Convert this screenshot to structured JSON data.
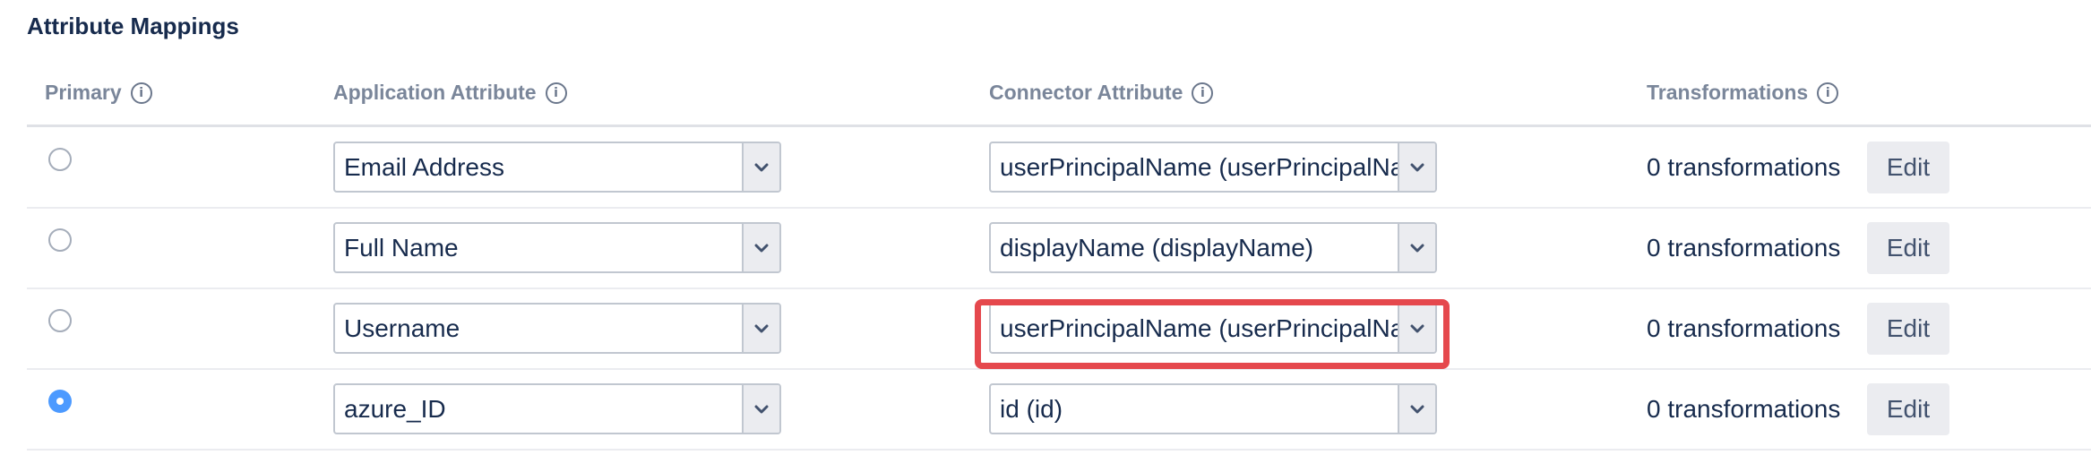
{
  "section": {
    "title": "Attribute Mappings"
  },
  "columns": {
    "primary": "Primary",
    "application": "Application Attribute",
    "connector": "Connector Attribute",
    "transformations": "Transformations"
  },
  "rows": [
    {
      "primary": false,
      "application": "Email Address",
      "connector": "userPrincipalName (userPrincipalName)",
      "transformations": "0 transformations",
      "edit": "Edit"
    },
    {
      "primary": false,
      "application": "Full Name",
      "connector": "displayName (displayName)",
      "transformations": "0 transformations",
      "edit": "Edit"
    },
    {
      "primary": false,
      "application": "Username",
      "connector": "userPrincipalName (userPrincipalName)",
      "transformations": "0 transformations",
      "edit": "Edit"
    },
    {
      "primary": true,
      "application": "azure_ID",
      "connector": "id (id)",
      "transformations": "0 transformations",
      "edit": "Edit"
    }
  ],
  "icons": {
    "info": "info-icon",
    "dropdown": "chevron-down-icon"
  },
  "colors": {
    "highlight": "#e5484d",
    "radio_selected": "#4c9aff"
  }
}
